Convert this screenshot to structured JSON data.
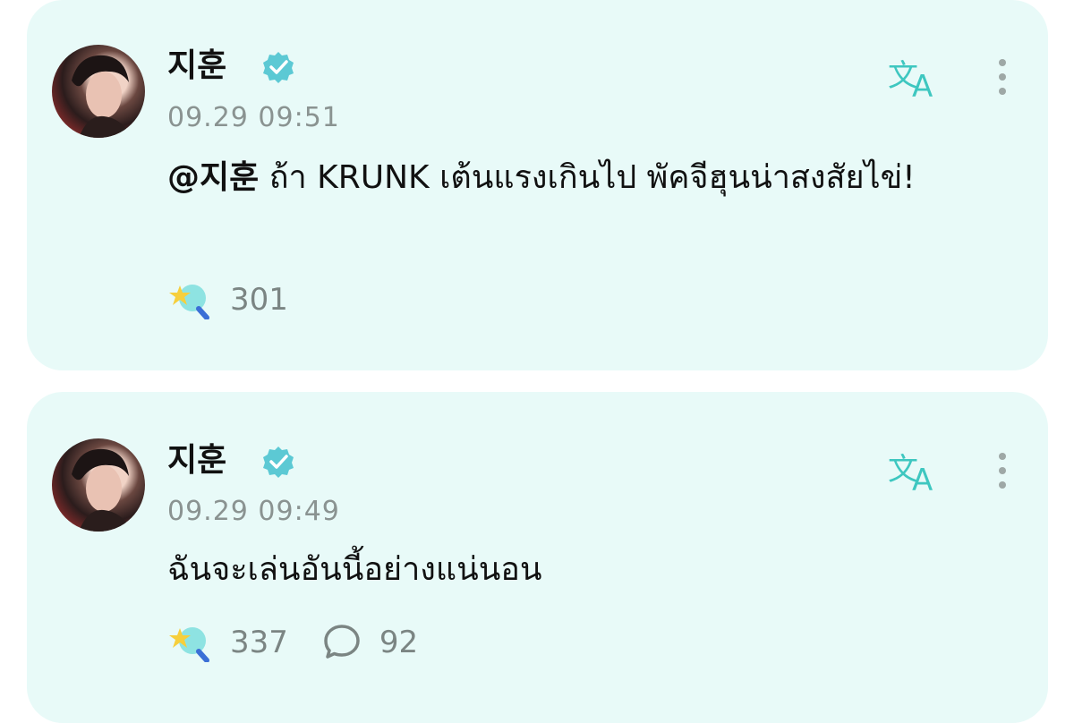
{
  "posts": [
    {
      "username": "지훈",
      "verified": true,
      "time": "09.29 09:51",
      "mention": "@지훈",
      "text": " ถ้า KRUNK เต้นแรงเกินไป พัคจีฮุนน่าสงสัยไข่!",
      "likes": "301",
      "comments": null
    },
    {
      "username": "지훈",
      "verified": true,
      "time": "09.29 09:49",
      "mention": "",
      "text": "ฉันจะเล่นอันนี้อย่างแน่นอน",
      "likes": "337",
      "comments": "92"
    }
  ],
  "colors": {
    "card_bg": "#e8faf8",
    "accent": "#3ec7c0",
    "verified": "#5cc9d4",
    "muted_text": "#8a9391"
  },
  "icons": {
    "verified": "verified-badge-icon",
    "translate": "translate-icon",
    "more": "more-vertical-icon",
    "like": "star-lightstick-icon",
    "comment": "comment-bubble-icon"
  }
}
